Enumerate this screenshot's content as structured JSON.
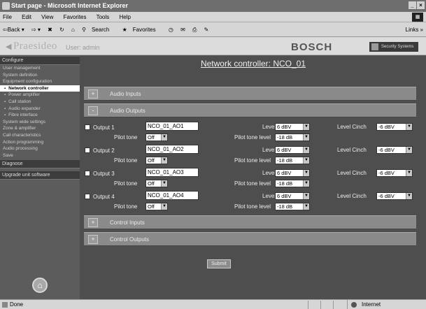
{
  "window": {
    "title": "Start page - Microsoft Internet Explorer",
    "controls": [
      "_",
      "×"
    ]
  },
  "menu": [
    "File",
    "Edit",
    "View",
    "Favorites",
    "Tools",
    "Help"
  ],
  "toolbar": {
    "back": "⇦Back ▾",
    "forward": "⇨ ▾",
    "search": "Search",
    "favorites": "Favorites",
    "links": "Links »"
  },
  "header": {
    "logo": "Praesideo",
    "user": "User: admin",
    "brand": "BOSCH",
    "brand_sub": "Security Systems"
  },
  "sidebar": {
    "sections": [
      {
        "label": "Configure",
        "items": [
          {
            "label": "User management",
            "sub": false,
            "active": false
          },
          {
            "label": "System definition",
            "sub": false,
            "active": false
          },
          {
            "label": "Equipment configuration",
            "sub": false,
            "active": false
          },
          {
            "label": "Network controller",
            "sub": true,
            "active": true
          },
          {
            "label": "Power amplifier",
            "sub": true,
            "active": false
          },
          {
            "label": "Call station",
            "sub": true,
            "active": false
          },
          {
            "label": "Audio expander",
            "sub": true,
            "active": false
          },
          {
            "label": "Fibre interface",
            "sub": true,
            "active": false
          },
          {
            "label": "System wide settings",
            "sub": false,
            "active": false
          },
          {
            "label": "Zone & amplifier",
            "sub": false,
            "active": false
          },
          {
            "label": "Call characteristics",
            "sub": false,
            "active": false
          },
          {
            "label": "Action programming",
            "sub": false,
            "active": false
          },
          {
            "label": "Audio processing",
            "sub": false,
            "active": false
          },
          {
            "label": "Save",
            "sub": false,
            "active": false
          }
        ]
      },
      {
        "label": "Diagnose",
        "items": []
      },
      {
        "label": "Upgrade unit software",
        "items": []
      }
    ]
  },
  "page_title": "Network controller: NCO_01",
  "sections": {
    "audio_inputs": {
      "toggle": "+",
      "label": "Audio Inputs"
    },
    "audio_outputs": {
      "toggle": "-",
      "label": "Audio Outputs"
    },
    "control_inputs": {
      "toggle": "+",
      "label": "Control Inputs"
    },
    "control_outputs": {
      "toggle": "+",
      "label": "Control Outputs"
    }
  },
  "labels": {
    "pilot_tone": "Pilot tone",
    "level_xlr": "Level XLR",
    "pilot_tone_level": "Pilot tone level",
    "level_cinch": "Level Cinch"
  },
  "outputs": [
    {
      "label": "Output 1",
      "name": "NCO_01_AO1",
      "pilot_tone": "Off",
      "level_xlr": "6 dBV",
      "pilot_tone_level": "-18 dB",
      "level_cinch": "-6 dBV"
    },
    {
      "label": "Output 2",
      "name": "NCO_01_AO2",
      "pilot_tone": "Off",
      "level_xlr": "6 dBV",
      "pilot_tone_level": "-18 dB",
      "level_cinch": "-6 dBV"
    },
    {
      "label": "Output 3",
      "name": "NCO_01_AO3",
      "pilot_tone": "Off",
      "level_xlr": "6 dBV",
      "pilot_tone_level": "-18 dB",
      "level_cinch": "-6 dBV"
    },
    {
      "label": "Output 4",
      "name": "NCO_01_AO4",
      "pilot_tone": "Off",
      "level_xlr": "6 dBV",
      "pilot_tone_level": "-18 dB",
      "level_cinch": "-6 dBV"
    }
  ],
  "submit": "Submit",
  "status": {
    "left": "Done",
    "zone": "Internet"
  }
}
